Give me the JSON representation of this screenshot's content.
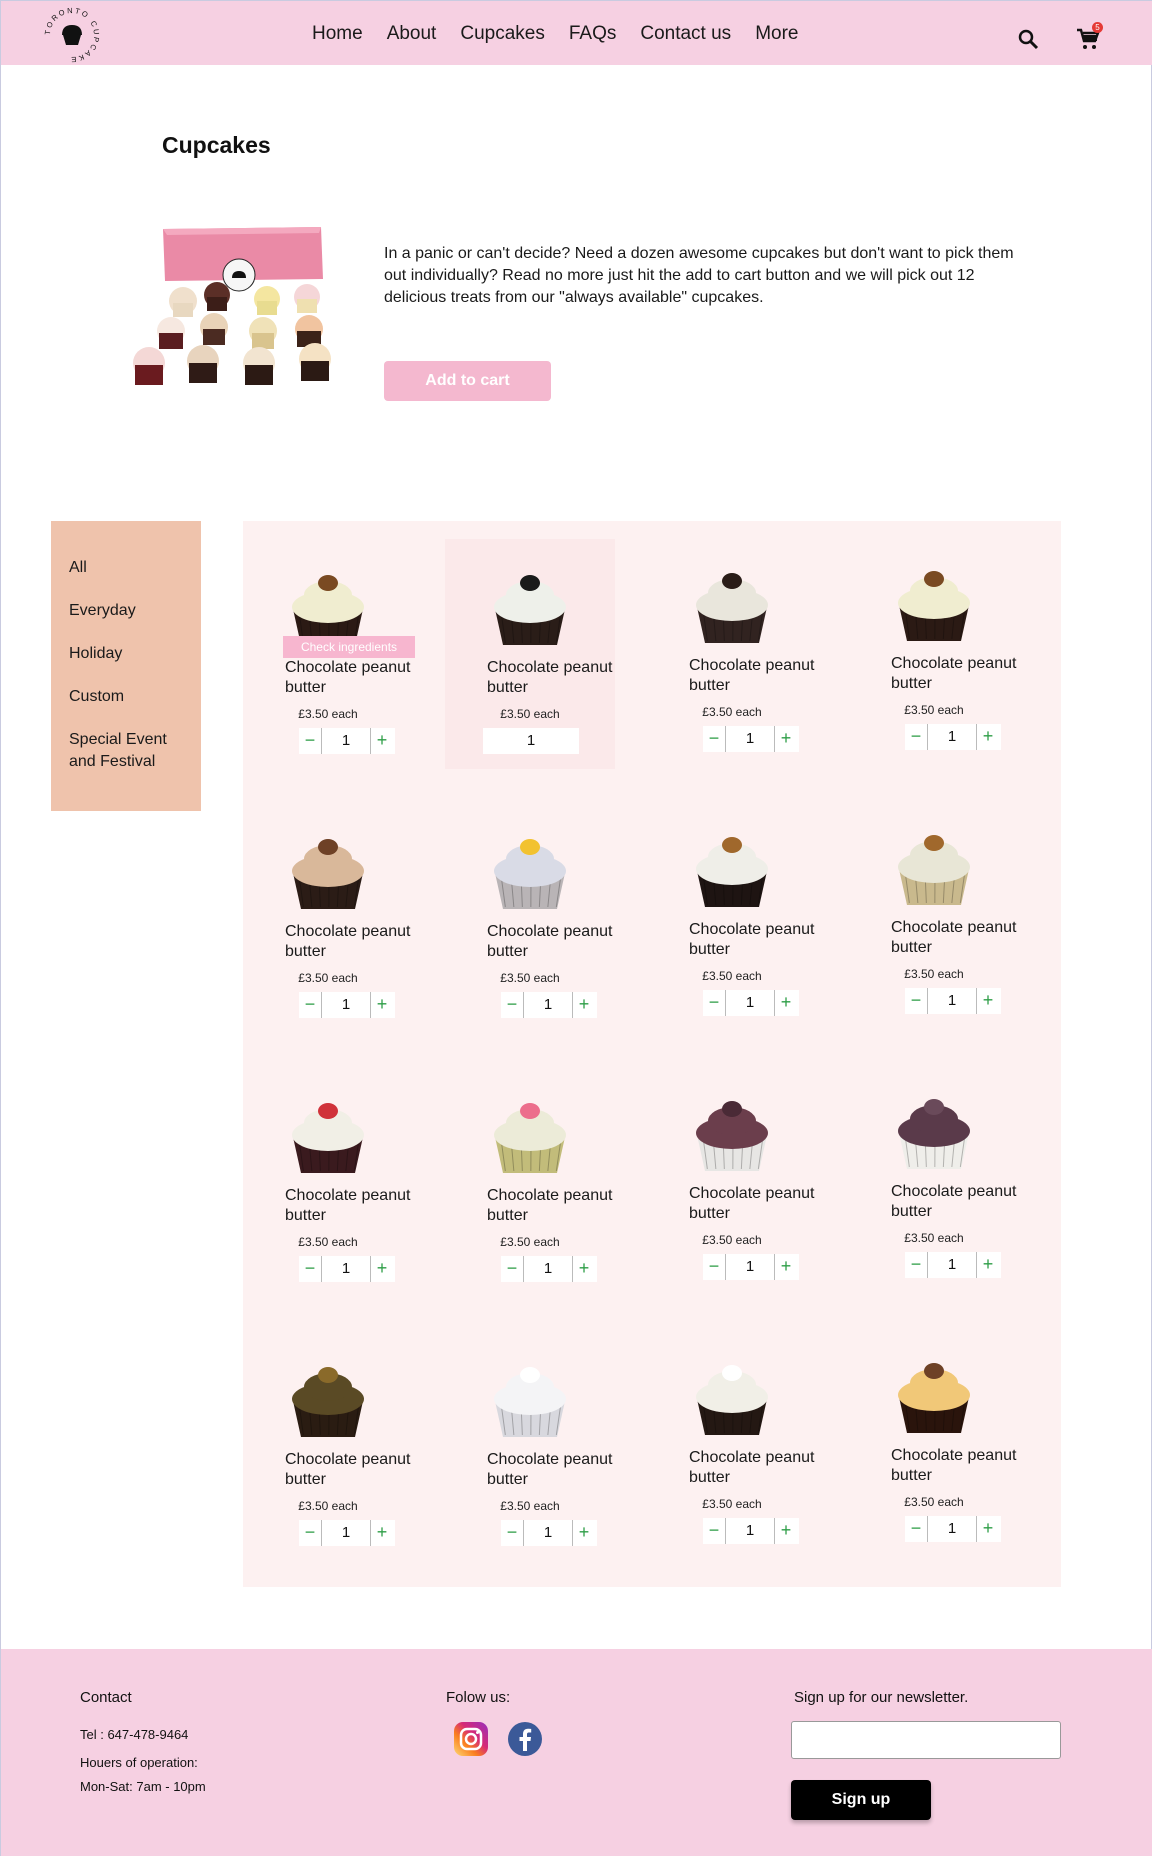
{
  "brand": {
    "logo_text": "TORONTO CUPCAKE"
  },
  "nav": [
    "Home",
    "About",
    "Cupcakes",
    "FAQs",
    "Contact us",
    "More"
  ],
  "header": {
    "cart_count": "5"
  },
  "page": {
    "title": "Cupcakes",
    "description": "In a panic or can't decide? Need a dozen awesome cupcakes but don't want to pick them out individually? Read no more just hit the add to cart button and we will pick out 12 delicious treats from our \"always available\" cupcakes.",
    "add_to_cart": "Add to cart"
  },
  "categories": [
    "All",
    "Everyday",
    "Holiday",
    "Custom",
    "Special Event and Festival"
  ],
  "products": [
    {
      "name": "Chocolate peanut butter",
      "price": "£3.50 each",
      "qty": "1",
      "cake": "#2b1a14",
      "frost": "#f0edd0",
      "top": "pecan",
      "check": "Check ingredients"
    },
    {
      "name": "Chocolate peanut butter",
      "price": "£3.50 each",
      "qty": "1",
      "cake": "#2a1d18",
      "frost": "#eef0ea",
      "top": "beads"
    },
    {
      "name": "Chocolate peanut butter",
      "price": "£3.50 each",
      "qty": "1",
      "cake": "#312320",
      "frost": "#e9e6dc",
      "top": "oreo"
    },
    {
      "name": "Chocolate peanut butter",
      "price": "£3.50 each",
      "qty": "1",
      "cake": "#2b1a14",
      "frost": "#f0edd0",
      "top": "pecan"
    },
    {
      "name": "Chocolate peanut butter",
      "price": "£3.50 each",
      "qty": "1",
      "cake": "#2b1c16",
      "frost": "#d9b89a",
      "top": "chips"
    },
    {
      "name": "Chocolate peanut butter",
      "price": "£3.50 each",
      "qty": "1",
      "cake": "#b9b4b6",
      "frost": "#d9dbe6",
      "top": "lemon"
    },
    {
      "name": "Chocolate peanut butter",
      "price": "£3.50 each",
      "qty": "1",
      "cake": "#1e1412",
      "frost": "#efeee8",
      "top": "crumble"
    },
    {
      "name": "Chocolate peanut butter",
      "price": "£3.50 each",
      "qty": "1",
      "cake": "#c9b98d",
      "frost": "#e8e6d6",
      "top": "crumble"
    },
    {
      "name": "Chocolate peanut butter",
      "price": "£3.50 each",
      "qty": "1",
      "cake": "#3a1a1e",
      "frost": "#f1efe6",
      "top": "rose"
    },
    {
      "name": "Chocolate peanut butter",
      "price": "£3.50 each",
      "qty": "1",
      "cake": "#c2bc7a",
      "frost": "#ecebd8",
      "top": "pinkflower"
    },
    {
      "name": "Chocolate peanut butter",
      "price": "£3.50 each",
      "qty": "1",
      "cake": "#e7e6e4",
      "frost": "#6b3e4c",
      "top": "ball"
    },
    {
      "name": "Chocolate peanut butter",
      "price": "£3.50 each",
      "qty": "1",
      "cake": "#efeeea",
      "frost": "#5a3a4a",
      "top": "glaze"
    },
    {
      "name": "Chocolate peanut butter",
      "price": "£3.50 each",
      "qty": "1",
      "cake": "#2a1c12",
      "frost": "#5a4a25",
      "top": "nuts"
    },
    {
      "name": "Chocolate peanut butter",
      "price": "£3.50 each",
      "qty": "1",
      "cake": "#d8d8de",
      "frost": "#f4f4f6",
      "top": "coconut"
    },
    {
      "name": "Chocolate peanut butter",
      "price": "£3.50 each",
      "qty": "1",
      "cake": "#241813",
      "frost": "#f1efe7",
      "top": "coconut"
    },
    {
      "name": "Chocolate peanut butter",
      "price": "£3.50 each",
      "qty": "1",
      "cake": "#2a140c",
      "frost": "#f1c878",
      "top": "chips"
    }
  ],
  "footer": {
    "contact_title": "Contact",
    "tel": "Tel : 647-478-9464",
    "hours_label": "Houers of operation:",
    "hours": "Mon-Sat: 7am - 10pm",
    "follow": "Folow us:",
    "newsletter": "Sign up for our newsletter.",
    "email_value": "",
    "signup": "Sign up"
  },
  "colors": {
    "header_bg": "#f6d0e2",
    "sidebar_bg": "#efc3ac",
    "grid_bg": "#fdf1f1",
    "button_pink": "#f4b8cf",
    "plus_minus": "#2e9e47"
  }
}
